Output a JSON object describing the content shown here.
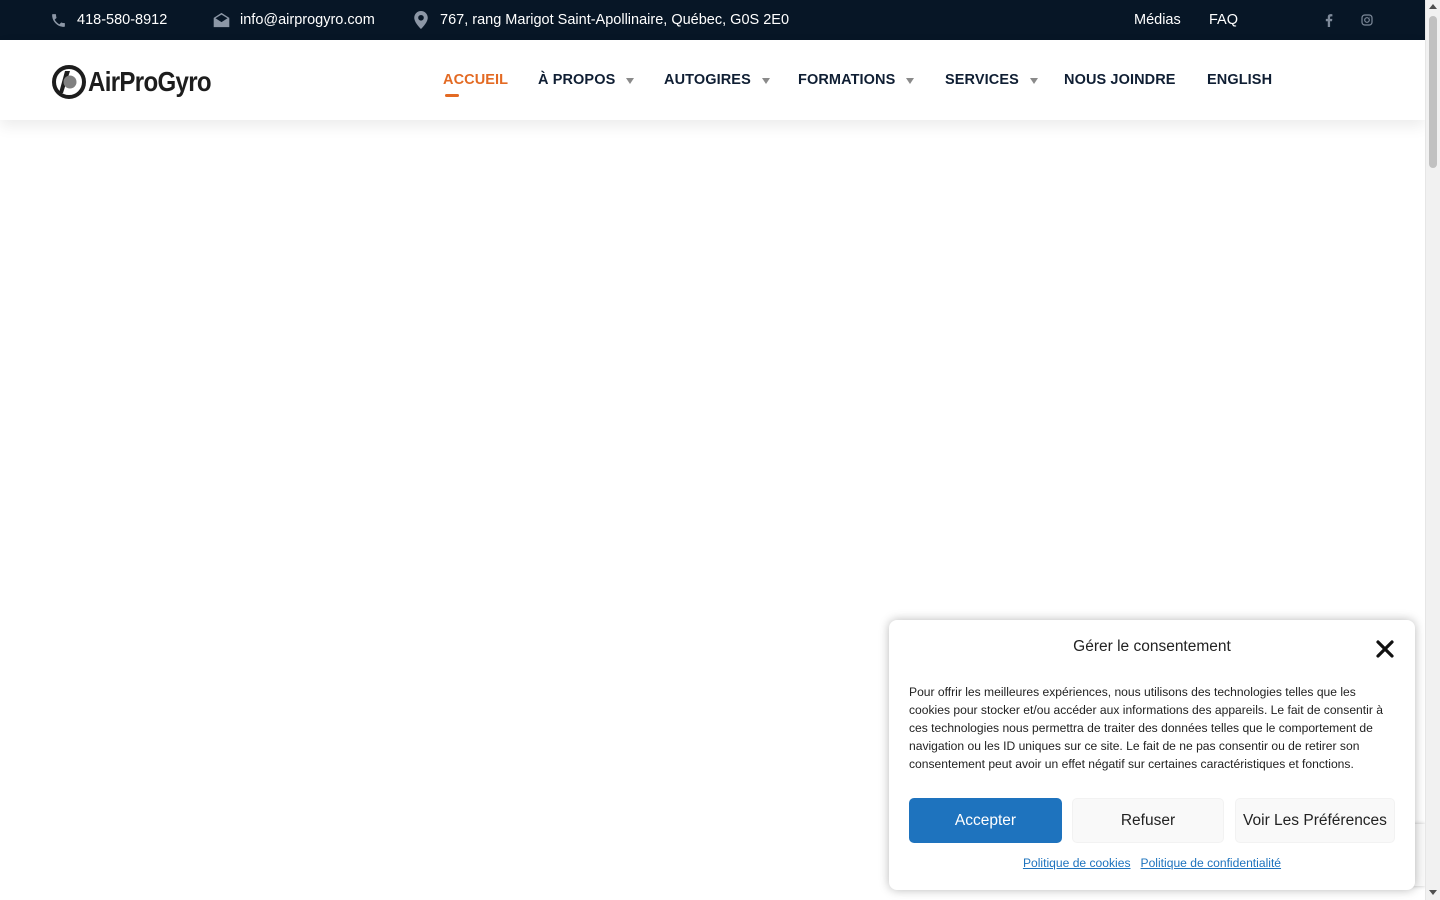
{
  "topbar": {
    "phone": "418-580-8912",
    "email": "info@airprogyro.com",
    "address": "767, rang Marigot Saint-Apollinaire, Québec, G0S 2E0",
    "links": [
      "Médias",
      "FAQ"
    ],
    "social": [
      "facebook-icon",
      "instagram-icon"
    ],
    "bg_color": "#071626"
  },
  "header": {
    "logo_text": "AirProGyro",
    "nav": [
      {
        "label": "ACCUEIL",
        "active": true
      },
      {
        "label": "À PROPOS",
        "dropdown": true
      },
      {
        "label": "AUTOGIRES",
        "dropdown": true
      },
      {
        "label": "FORMATIONS",
        "dropdown": true
      },
      {
        "label": "SERVICES",
        "dropdown": true
      },
      {
        "label": "NOUS JOINDRE"
      },
      {
        "label": "ENGLISH"
      }
    ],
    "accent_color": "#e36a23"
  },
  "consent": {
    "title": "Gérer le consentement",
    "body": "Pour offrir les meilleures expériences, nous utilisons des technologies telles que les cookies pour stocker et/ou accéder aux informations des appareils. Le fait de consentir à ces technologies nous permettra de traiter des données telles que le comportement de navigation ou les ID uniques sur ce site. Le fait de ne pas consentir ou de retirer son consentement peut avoir un effet négatif sur certaines caractéristiques et fonctions.",
    "accept_label": "Accepter",
    "deny_label": "Refuser",
    "prefs_label": "Voir Les Préférences",
    "cookie_policy_label": "Politique de cookies",
    "privacy_policy_label": "Politique de confidentialité",
    "accept_color": "#1e73be"
  }
}
